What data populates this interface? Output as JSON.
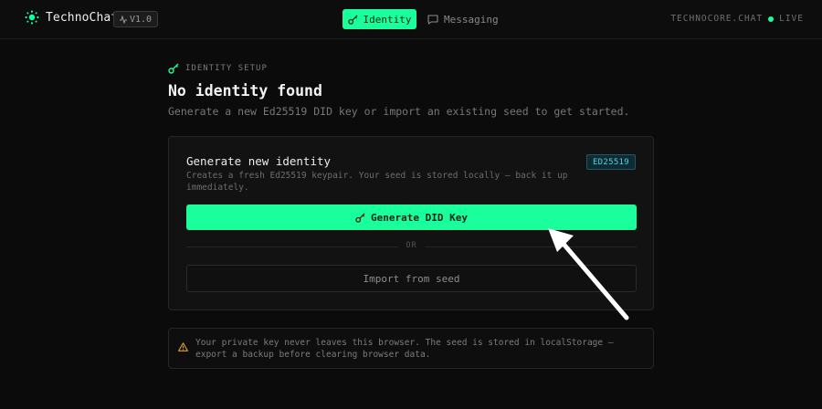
{
  "header": {
    "app_name": "TechnoChat",
    "version": "V1.0",
    "nav": [
      {
        "label": "Identity",
        "active": true
      },
      {
        "label": "Messaging",
        "active": false
      }
    ],
    "server": "TECHNOCORE.CHAT",
    "status": "LIVE"
  },
  "setup": {
    "eyebrow": "IDENTITY SETUP",
    "title": "No identity found",
    "subtitle": "Generate a new Ed25519 DID key or import an existing seed to get started."
  },
  "card": {
    "title": "Generate new identity",
    "description": "Creates a fresh Ed25519 keypair. Your seed is stored locally — back it up immediately.",
    "badge": "ED25519",
    "generate_label": "Generate DID Key",
    "divider": "OR",
    "import_label": "Import from seed"
  },
  "warning": {
    "text": "Your private key never leaves this browser. The seed is stored in localStorage — export a backup before clearing browser data."
  },
  "colors": {
    "accent": "#1aff9c",
    "background": "#0b0b0b",
    "badge_text": "#4fd4e4",
    "warning_icon": "#e0a030"
  }
}
